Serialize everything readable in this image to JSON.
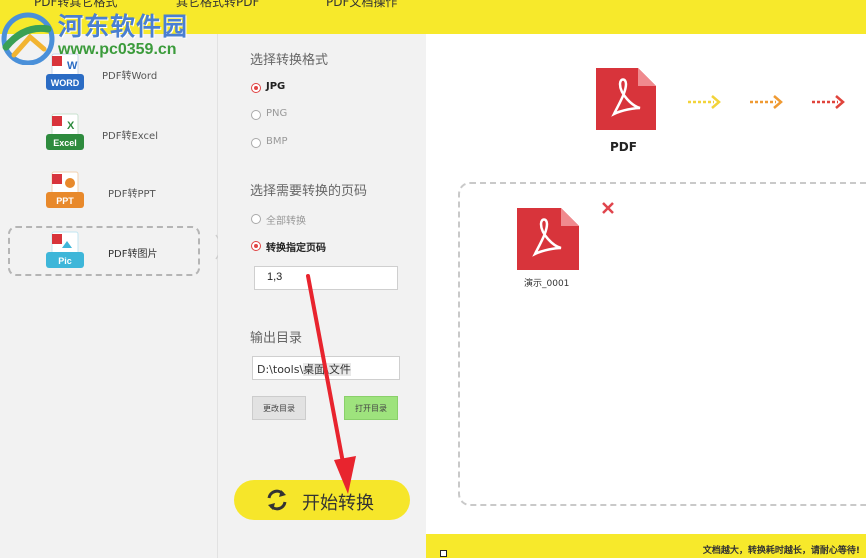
{
  "tabs": [
    {
      "label": "PDF转其它格式"
    },
    {
      "label": "其它格式转PDF"
    },
    {
      "label": "PDF文档操作"
    }
  ],
  "watermark": {
    "title": "河东软件园",
    "url": "www.pc0359.cn"
  },
  "menu": [
    {
      "label": "PDF转Word",
      "badge": "WORD",
      "color": "#2b6cc4",
      "icon": "word-icon"
    },
    {
      "label": "PDF转Excel",
      "badge": "Excel",
      "color": "#2e8b3e",
      "icon": "excel-icon"
    },
    {
      "label": "PDF转PPT",
      "badge": "PPT",
      "color": "#e8892b",
      "icon": "ppt-icon"
    },
    {
      "label": "PDF转图片",
      "badge": "Pic",
      "color": "#3eb6d9",
      "icon": "pic-icon",
      "active": true
    }
  ],
  "options": {
    "format_title": "选择转换格式",
    "formats": [
      {
        "label": "JPG",
        "selected": true
      },
      {
        "label": "PNG",
        "selected": false
      },
      {
        "label": "BMP",
        "selected": false
      }
    ],
    "page_title": "选择需要转换的页码",
    "page_modes": [
      {
        "label": "全部转换",
        "selected": false
      },
      {
        "label": "转换指定页码",
        "selected": true
      }
    ],
    "page_value": "1,3",
    "output_title": "输出目录",
    "output_path_plain": "D:\\tools\\",
    "output_path_highlight": "桌面\\文件",
    "change_dir_label": "更改目录",
    "open_dir_label": "打开目录",
    "start_label": "开始转换"
  },
  "preview": {
    "pdf_label": "PDF",
    "file_name": "演示_0001"
  },
  "status_text": "文档越大，转换耗时越长，请耐心等待!",
  "colors": {
    "yellow": "#f7e92b",
    "pdf_red": "#d8343b",
    "green_button": "#9ee37d",
    "arrow1": "#f2d33a",
    "arrow2": "#ef9a33",
    "arrow3": "#e0443c"
  }
}
